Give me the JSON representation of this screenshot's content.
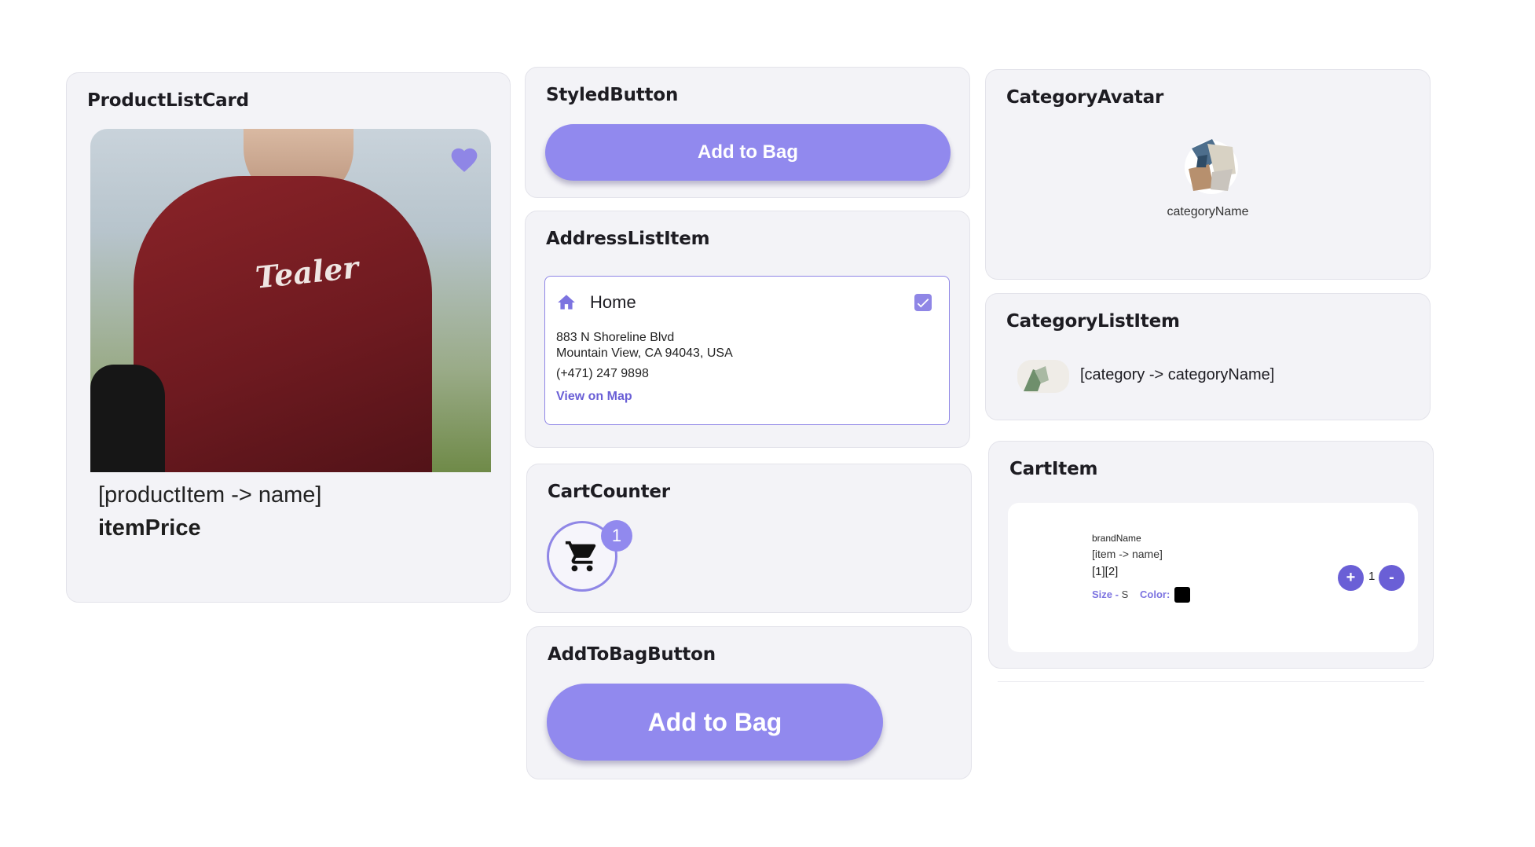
{
  "colors": {
    "accent": "#9189ee",
    "accent_dark": "#6a5fd6",
    "card_bg": "#f3f3f7"
  },
  "product_list_card": {
    "title": "ProductListCard",
    "name": "[productItem -> name]",
    "price": "itemPrice",
    "image_icon": "tshirt-model-photo",
    "shirt_logo": "Tealer",
    "favorite_icon": "heart-icon"
  },
  "styled_button": {
    "title": "StyledButton",
    "label": "Add to Bag"
  },
  "address_list_item": {
    "title": "AddressListItem",
    "icon": "home-icon",
    "name": "Home",
    "line1": "883 N Shoreline Blvd",
    "line2": "Mountain View, CA 94043, USA",
    "phone": "(+471) 247 9898",
    "map_link": "View on Map",
    "selected": true
  },
  "cart_counter": {
    "title": "CartCounter",
    "icon": "cart-icon",
    "count": "1"
  },
  "add_to_bag_button": {
    "title": "AddToBagButton",
    "label": "Add to Bag"
  },
  "category_avatar": {
    "title": "CategoryAvatar",
    "image_icon": "clothes-pile-image",
    "name": "categoryName"
  },
  "category_list_item": {
    "title": "CategoryListItem",
    "image_icon": "category-thumbnail-image",
    "name": "[category -> categoryName]"
  },
  "cart_item": {
    "title": "CartItem",
    "brand": "brandName",
    "name": "[item -> name]",
    "price": "[1][2]",
    "size_label": "Size -",
    "size_value": "S",
    "color_label": "Color:",
    "color_value": "#000000",
    "plus_label": "+",
    "minus_label": "-",
    "quantity": "1"
  }
}
